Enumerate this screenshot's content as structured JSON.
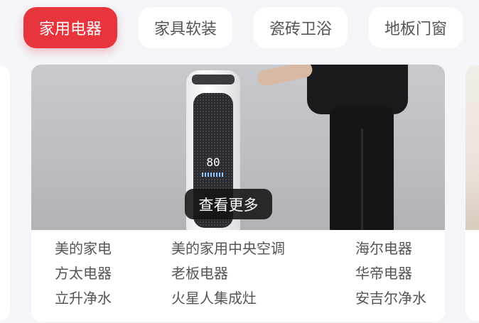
{
  "tabs": [
    {
      "label": "家用电器",
      "active": true
    },
    {
      "label": "家具软装",
      "active": false
    },
    {
      "label": "瓷砖卫浴",
      "active": false
    },
    {
      "label": "地板门窗",
      "active": false
    }
  ],
  "card": {
    "display_value": "80",
    "view_more_label": "查看更多",
    "brands": [
      "美的家电",
      "美的家用中央空调",
      "海尔电器",
      "方太电器",
      "老板电器",
      "华帝电器",
      "立升净水",
      "火星人集成灶",
      "安吉尔净水"
    ]
  },
  "colors": {
    "accent": "#e8343c",
    "background": "#f3f5f9"
  }
}
